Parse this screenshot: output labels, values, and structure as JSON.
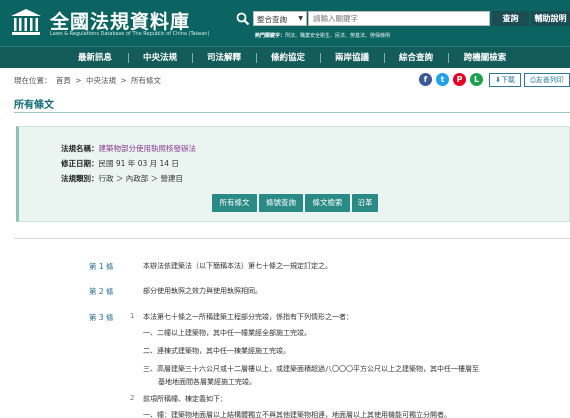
{
  "header": {
    "title": "全國法規資料庫",
    "subtitle": "Laws & Regulations Database of The Republic of China (Taiwan)",
    "search": {
      "scope": "整合查詢",
      "placeholder": "請輸入關鍵字",
      "button": "查詢"
    },
    "help": "輔助說明",
    "hot_keys_label": "熱門關鍵字：",
    "hot_keys": "刑法、職業安全衛生、民法、勞基法、勞保條例"
  },
  "nav": [
    "最新訊息",
    "中央法規",
    "司法解釋",
    "條約協定",
    "兩岸協議",
    "綜合查詢",
    "跨機關檢索"
  ],
  "breadcrumb": {
    "prefix": "現在位置：",
    "items": [
      "首頁",
      "中央法規",
      "所有條文"
    ],
    "sep": ">"
  },
  "actions": {
    "download": "下載",
    "print": "友善列印"
  },
  "section_title": "所有條文",
  "law": {
    "name_label": "法規名稱：",
    "name": "建築物部分使用執照核發辦法",
    "date_label": "修正日期：",
    "date": "民國 91 年 03 月 14 日",
    "category_label": "法規類別：",
    "category": "行政 ＞ 內政部 ＞ 營建目"
  },
  "tabs": [
    "所有條文",
    "條號查詢",
    "條文檢索",
    "沿革"
  ],
  "articles": [
    {
      "label": "第 1 條",
      "text": "本辦法依建築法（以下簡稱本法）第七十條之一規定訂定之。"
    },
    {
      "label": "第 2 條",
      "text": "部分使用執照之效力與使用執照相同。"
    },
    {
      "label": "第 3 條",
      "item1_num": "1",
      "item1_text": "本法第七十條之一所稱建築工程部分完竣，係指有下列情形之一者：",
      "subs": [
        "一、二幢以上建築物，其中任一幢業經全部施工完竣。",
        "二、連棟式建築物，其中任一棟業經施工完竣。",
        "三、高層建築三十六公尺或十二層樓以上，或建築面積超過八〇〇〇平方公尺以上之建築物，其中任一樓層至",
        "基地地面間各層業經施工完竣。"
      ],
      "item2_num": "2",
      "item2_text": "前項所稱幢、棟定義如下：",
      "item2_sub": "一、幢：建築物地面層以上結構體獨立不與其他建築物相連，地面層以上其使用機能可獨立分開者。"
    }
  ],
  "colors": {
    "header_bg": "#0b6461",
    "nav_bg": "#135c5a",
    "accent": "#2a8a86"
  }
}
